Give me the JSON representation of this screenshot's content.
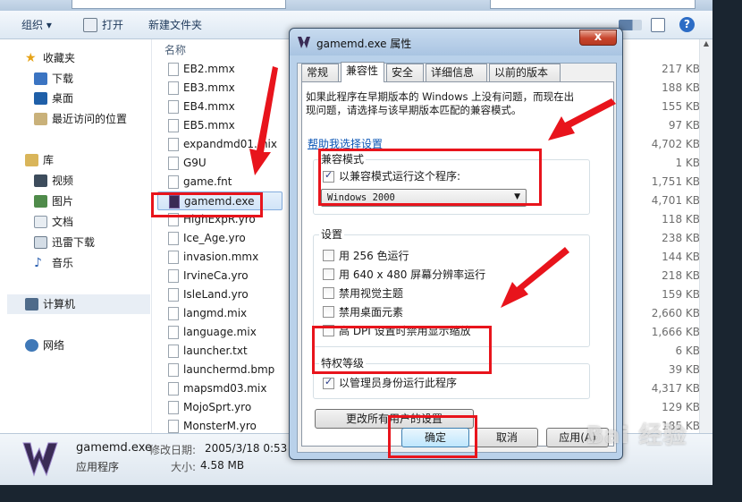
{
  "explorer": {
    "toolbar": {
      "organize": "组织 ▾",
      "open": "打开",
      "new_folder": "新建文件夹"
    },
    "nav": {
      "favorites": "收藏夹",
      "downloads": "下载",
      "desktop": "桌面",
      "recent": "最近访问的位置",
      "libraries": "库",
      "videos": "视频",
      "pictures": "图片",
      "documents": "文档",
      "xunlei": "迅雷下载",
      "music": "音乐",
      "computer": "计算机",
      "network": "网络"
    },
    "column_name": "名称",
    "files": [
      "EB2.mmx",
      "EB3.mmx",
      "EB4.mmx",
      "EB5.mmx",
      "expandmd01.mix",
      "G9U",
      "game.fnt",
      "gamemd.exe",
      "HighExpR.yro",
      "Ice_Age.yro",
      "invasion.mmx",
      "IrvineCa.yro",
      "IsleLand.yro",
      "langmd.mix",
      "language.mix",
      "launcher.txt",
      "launchermd.bmp",
      "mapsmd03.mix",
      "MojoSprt.yro",
      "MonsterM.yro"
    ],
    "sizes": [
      "217 KB",
      "188 KB",
      "155 KB",
      "97 KB",
      "4,702 KB",
      "1 KB",
      "1,751 KB",
      "4,701 KB",
      "118 KB",
      "238 KB",
      "144 KB",
      "218 KB",
      "159 KB",
      "2,660 KB",
      "1,666 KB",
      "6 KB",
      "39 KB",
      "4,317 KB",
      "129 KB",
      "185 KB"
    ],
    "details": {
      "filename": "gamemd.exe",
      "type": "应用程序",
      "modified_label": "修改日期:",
      "modified_value": "2005/3/18 0:53",
      "size_label": "大小:",
      "size_value": "4.58 MB"
    }
  },
  "dialog": {
    "title": "gamemd.exe 属性",
    "close": "x",
    "tabs": [
      "常规",
      "兼容性",
      "安全",
      "详细信息",
      "以前的版本"
    ],
    "active_tab": "兼容性",
    "intro": [
      "如果此程序在早期版本的 Windows 上没有问题，而现在出",
      "现问题，请选择与该早期版本匹配的兼容模式。"
    ],
    "help_link": "帮助我选择设置",
    "compat_group": {
      "title": "兼容模式",
      "checkbox": "以兼容模式运行这个程序:",
      "checked": true,
      "select_value": "Windows 2000"
    },
    "settings_group": {
      "title": "设置",
      "items": [
        {
          "label": "用 256 色运行",
          "checked": false
        },
        {
          "label": "用 640 x 480 屏幕分辨率运行",
          "checked": false
        },
        {
          "label": "禁用视觉主题",
          "checked": false
        },
        {
          "label": "禁用桌面元素",
          "checked": false
        },
        {
          "label": "高 DPI 设置时禁用显示缩放",
          "checked": false
        }
      ]
    },
    "privilege_group": {
      "title": "特权等级",
      "checkbox": "以管理员身份运行此程序",
      "checked": true
    },
    "all_users_button": "更改所有用户的设置",
    "buttons": {
      "ok": "确定",
      "cancel": "取消",
      "apply": "应用(A)"
    }
  },
  "watermark": "Bai 经验",
  "colors": {
    "annotation": "#e8141c",
    "link": "#0a55b5",
    "dialog_frame": "#b9d1ea"
  }
}
